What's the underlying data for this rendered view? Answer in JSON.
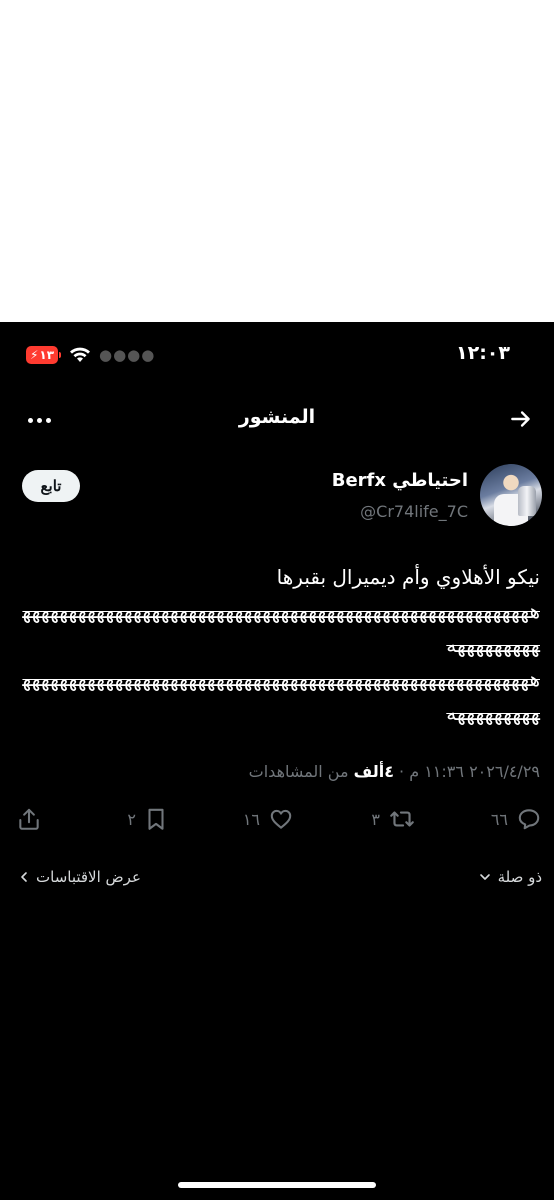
{
  "status_bar": {
    "time": "١٢:٠٣",
    "battery": "١٣"
  },
  "header": {
    "title": "المنشور"
  },
  "author": {
    "display_name": "احتياطي Berfx",
    "handle": "@Cr74life_7C",
    "follow_label": "تابع"
  },
  "tweet": {
    "line1": "نيكو الأهلاوي وأم ديميرال بقبرها",
    "line2": "هههههههههههههههههههههههههههههههههههههههههههههههههههههههههههههههههه",
    "line3": "هههههههههههههههههههههههههههههههههههههههههههههههههههههههههههههههههه"
  },
  "meta": {
    "timestamp": "٢٠٢٦/٤/٢٩ ١١:٣٦ م · ",
    "views_count": "٤ألف",
    "views_label": " من المشاهدات"
  },
  "actions": {
    "replies": "٦٦",
    "retweets": "٣",
    "likes": "١٦",
    "bookmarks": "٢"
  },
  "footer": {
    "related_label": "ذو صلة",
    "quotes_label": "عرض الاقتباسات"
  }
}
